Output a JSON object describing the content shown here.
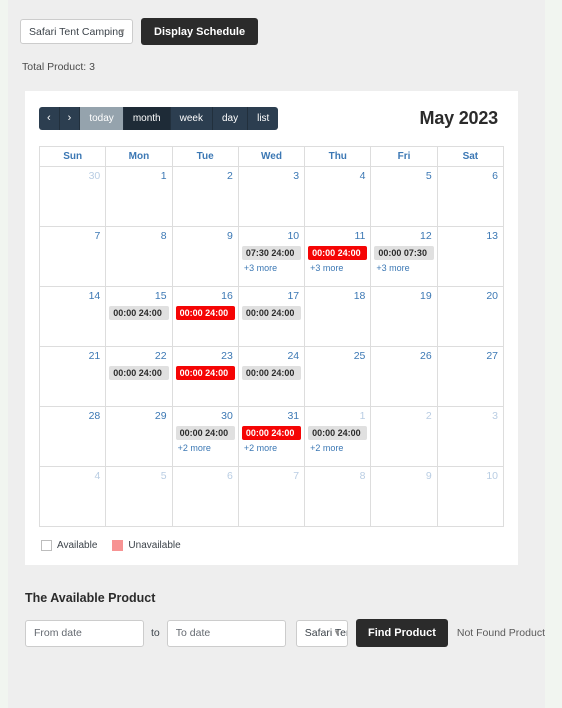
{
  "topbar": {
    "product_select": {
      "value": "Safari Tent Camping",
      "caret": "chevron-down-icon"
    },
    "display_schedule_label": "Display Schedule",
    "total_product": "Total Product: 3"
  },
  "calendar": {
    "toolbar": {
      "prev": "‹",
      "next": "›",
      "today": "today",
      "month": "month",
      "week": "week",
      "day": "day",
      "list": "list"
    },
    "title": "May 2023",
    "weekdays": [
      "Sun",
      "Mon",
      "Tue",
      "Wed",
      "Thu",
      "Fri",
      "Sat"
    ],
    "weeks": [
      [
        {
          "num": "30",
          "other": true,
          "bg": "none",
          "events": [],
          "more": ""
        },
        {
          "num": "1",
          "other": false,
          "bg": "none",
          "events": [],
          "more": ""
        },
        {
          "num": "2",
          "other": false,
          "bg": "none",
          "events": [],
          "more": ""
        },
        {
          "num": "3",
          "other": false,
          "bg": "none",
          "events": [],
          "more": ""
        },
        {
          "num": "4",
          "other": false,
          "bg": "none",
          "events": [],
          "more": ""
        },
        {
          "num": "5",
          "other": false,
          "bg": "none",
          "events": [],
          "more": ""
        },
        {
          "num": "6",
          "other": false,
          "bg": "none",
          "events": [],
          "more": ""
        }
      ],
      [
        {
          "num": "7",
          "other": false,
          "bg": "none",
          "events": [],
          "more": ""
        },
        {
          "num": "8",
          "other": false,
          "bg": "none",
          "events": [],
          "more": ""
        },
        {
          "num": "9",
          "other": false,
          "bg": "none",
          "events": [],
          "more": ""
        },
        {
          "num": "10",
          "other": false,
          "bg": "none",
          "events": [
            {
              "label": "07:30 24:00",
              "state": "gray"
            }
          ],
          "more": "+3 more"
        },
        {
          "num": "11",
          "other": false,
          "bg": "unavail-a",
          "events": [
            {
              "label": "00:00 24:00",
              "state": "red"
            }
          ],
          "more": "+3 more"
        },
        {
          "num": "12",
          "other": false,
          "bg": "none",
          "events": [
            {
              "label": "00:00 07:30",
              "state": "gray"
            }
          ],
          "more": "+3 more"
        },
        {
          "num": "13",
          "other": false,
          "bg": "none",
          "events": [],
          "more": ""
        }
      ],
      [
        {
          "num": "14",
          "other": false,
          "bg": "none",
          "events": [],
          "more": ""
        },
        {
          "num": "15",
          "other": false,
          "bg": "none",
          "events": [
            {
              "label": "00:00 24:00",
              "state": "gray"
            }
          ],
          "more": ""
        },
        {
          "num": "16",
          "other": false,
          "bg": "none",
          "events": [
            {
              "label": "00:00 24:00",
              "state": "red"
            }
          ],
          "more": ""
        },
        {
          "num": "17",
          "other": false,
          "bg": "none",
          "events": [
            {
              "label": "00:00 24:00",
              "state": "gray"
            }
          ],
          "more": ""
        },
        {
          "num": "18",
          "other": false,
          "bg": "none",
          "events": [],
          "more": ""
        },
        {
          "num": "19",
          "other": false,
          "bg": "none",
          "events": [],
          "more": ""
        },
        {
          "num": "20",
          "other": false,
          "bg": "none",
          "events": [],
          "more": ""
        }
      ],
      [
        {
          "num": "21",
          "other": false,
          "bg": "none",
          "events": [],
          "more": ""
        },
        {
          "num": "22",
          "other": false,
          "bg": "none",
          "events": [
            {
              "label": "00:00 24:00",
              "state": "gray"
            }
          ],
          "more": ""
        },
        {
          "num": "23",
          "other": false,
          "bg": "none",
          "events": [
            {
              "label": "00:00 24:00",
              "state": "red"
            }
          ],
          "more": ""
        },
        {
          "num": "24",
          "other": false,
          "bg": "none",
          "events": [
            {
              "label": "00:00 24:00",
              "state": "gray"
            }
          ],
          "more": ""
        },
        {
          "num": "25",
          "other": false,
          "bg": "none",
          "events": [],
          "more": ""
        },
        {
          "num": "26",
          "other": false,
          "bg": "none",
          "events": [],
          "more": ""
        },
        {
          "num": "27",
          "other": false,
          "bg": "none",
          "events": [],
          "more": ""
        }
      ],
      [
        {
          "num": "28",
          "other": false,
          "bg": "none",
          "events": [],
          "more": ""
        },
        {
          "num": "29",
          "other": false,
          "bg": "none",
          "events": [],
          "more": ""
        },
        {
          "num": "30",
          "other": false,
          "bg": "unavail-b",
          "events": [
            {
              "label": "00:00 24:00",
              "state": "gray"
            }
          ],
          "more": "+2 more"
        },
        {
          "num": "31",
          "other": false,
          "bg": "unavail-b",
          "events": [
            {
              "label": "00:00 24:00",
              "state": "red"
            }
          ],
          "more": "+2 more"
        },
        {
          "num": "1",
          "other": true,
          "bg": "unavail-b",
          "events": [
            {
              "label": "00:00 24:00",
              "state": "gray"
            }
          ],
          "more": "+2 more"
        },
        {
          "num": "2",
          "other": true,
          "bg": "none",
          "events": [],
          "more": ""
        },
        {
          "num": "3",
          "other": true,
          "bg": "none",
          "events": [],
          "more": ""
        }
      ],
      [
        {
          "num": "4",
          "other": true,
          "bg": "none",
          "events": [],
          "more": ""
        },
        {
          "num": "5",
          "other": true,
          "bg": "none",
          "events": [],
          "more": ""
        },
        {
          "num": "6",
          "other": true,
          "bg": "none",
          "events": [],
          "more": ""
        },
        {
          "num": "7",
          "other": true,
          "bg": "none",
          "events": [],
          "more": ""
        },
        {
          "num": "8",
          "other": true,
          "bg": "none",
          "events": [],
          "more": ""
        },
        {
          "num": "9",
          "other": true,
          "bg": "none",
          "events": [],
          "more": ""
        },
        {
          "num": "10",
          "other": true,
          "bg": "none",
          "events": [],
          "more": ""
        }
      ]
    ],
    "legend": [
      {
        "label": "Available",
        "swatch": "avail"
      },
      {
        "label": "Unavailable",
        "swatch": "unavail"
      }
    ]
  },
  "available_product": {
    "heading": "The Available Product",
    "from_placeholder": "From date",
    "from_value": "",
    "to_label": "to",
    "to_placeholder": "To date",
    "to_value": "",
    "product_select": {
      "value": "Safari Tent Camping",
      "caret": "chevron-down-icon"
    },
    "find_label": "Find Product",
    "status": "Not Found Product"
  },
  "colors": {
    "accent_blue": "#3c78b4",
    "toolbar_dark": "#2c3e50",
    "toolbar_active": "#1e2b37",
    "toolbar_disabled": "#95a3ad",
    "event_red": "#f50505",
    "event_gray": "#e0e0e0",
    "unavailable_a": "#f9ae9a",
    "unavailable_b": "#fbb4b4",
    "button_dark": "#2b2b2b",
    "page_bg": "#eeeeee"
  }
}
